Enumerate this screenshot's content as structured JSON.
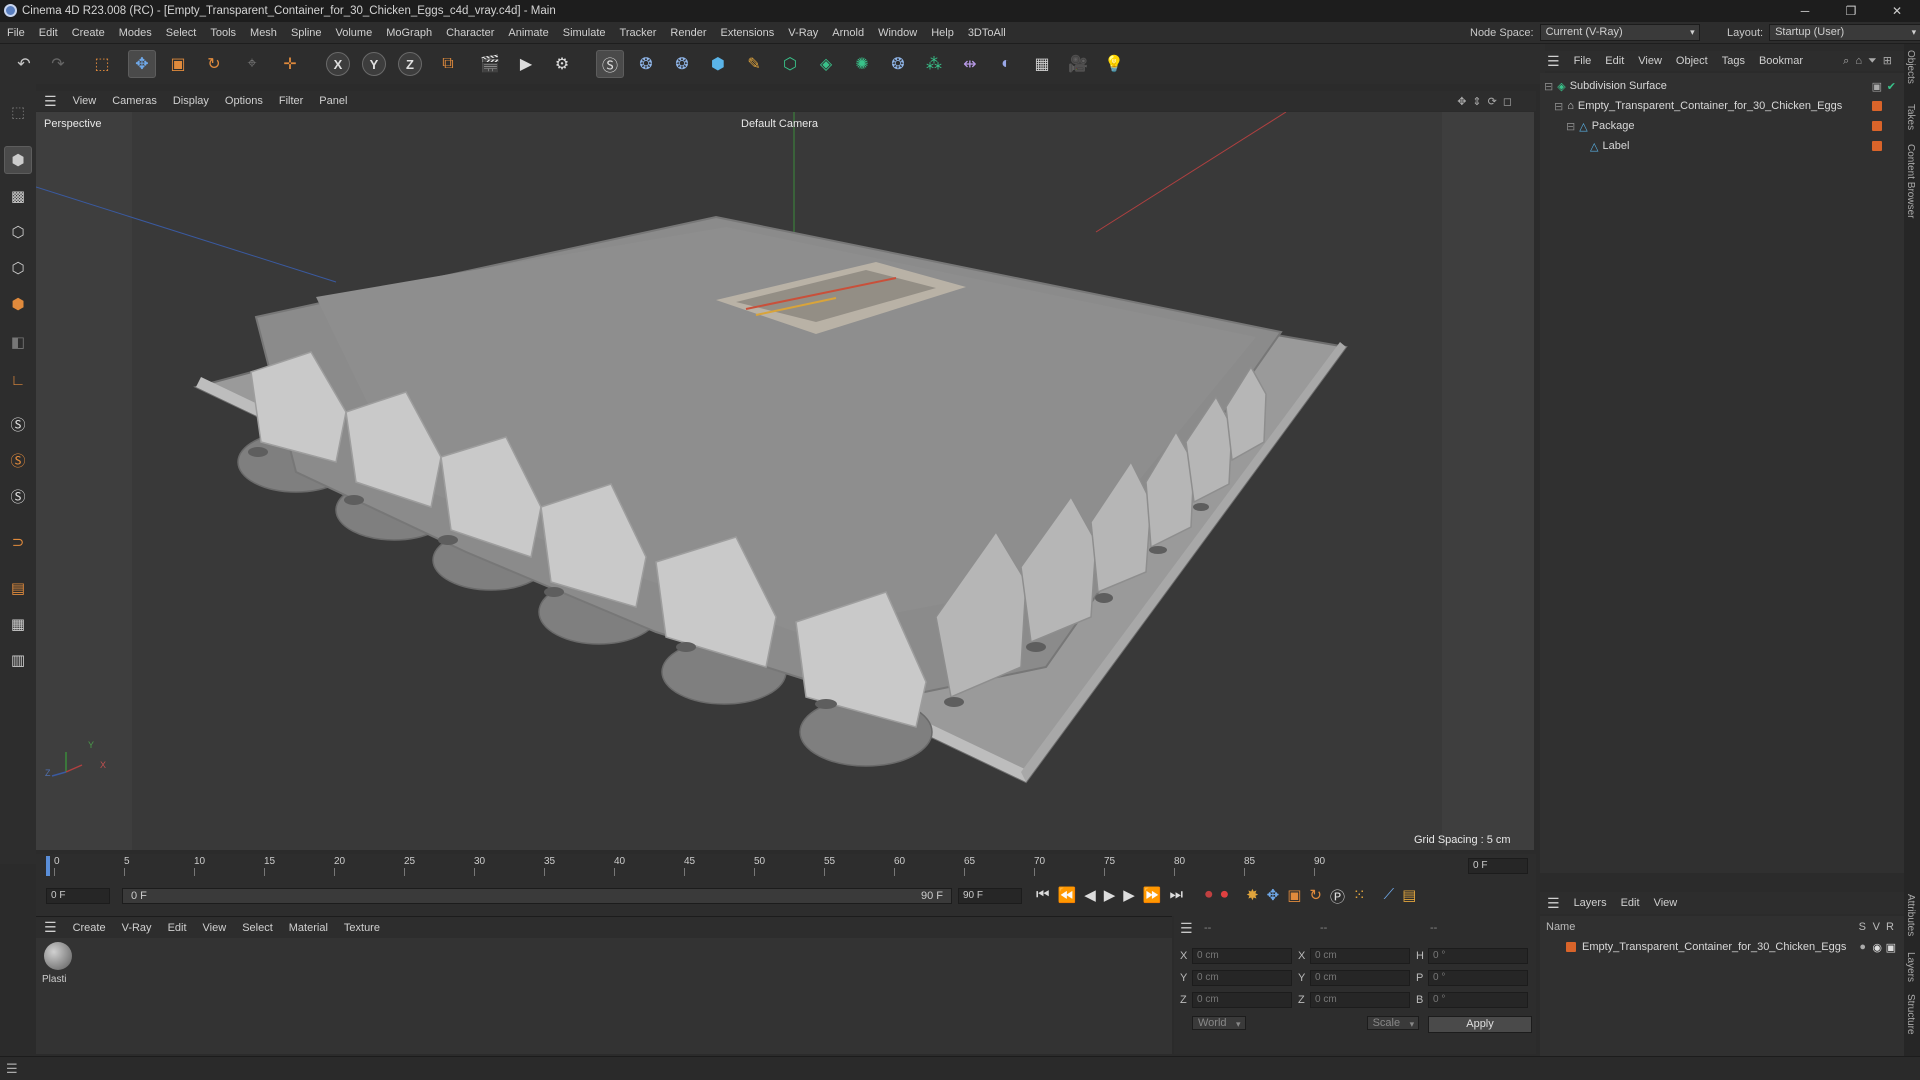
{
  "window": {
    "title": "Cinema 4D R23.008 (RC) - [Empty_Transparent_Container_for_30_Chicken_Eggs_c4d_vray.c4d] - Main",
    "min": "─",
    "max": "❐",
    "close": "✕"
  },
  "menubar": {
    "items": [
      "File",
      "Edit",
      "Create",
      "Modes",
      "Select",
      "Tools",
      "Mesh",
      "Spline",
      "Volume",
      "MoGraph",
      "Character",
      "Animate",
      "Simulate",
      "Tracker",
      "Render",
      "Extensions",
      "V-Ray",
      "Arnold",
      "Window",
      "Help",
      "3DToAll"
    ]
  },
  "nodespace": {
    "label": "Node Space:",
    "value": "Current (V-Ray)"
  },
  "layout": {
    "label": "Layout:",
    "value": "Startup (User)"
  },
  "viewport": {
    "menu": [
      "View",
      "Cameras",
      "Display",
      "Options",
      "Filter",
      "Panel"
    ],
    "name": "Perspective",
    "camera": "Default Camera",
    "grid_spacing": "Grid Spacing : 5 cm",
    "axis": {
      "x": "X",
      "y": "Y",
      "z": "Z"
    }
  },
  "timeline": {
    "ticks": [
      "0",
      "5",
      "10",
      "15",
      "20",
      "25",
      "30",
      "35",
      "40",
      "45",
      "50",
      "55",
      "60",
      "65",
      "70",
      "75",
      "80",
      "85",
      "90"
    ],
    "current_frame": "0 F",
    "start": "0 F",
    "range_start": "0 F",
    "range_end": "90 F",
    "end": "90 F"
  },
  "materials": {
    "menu": [
      "Create",
      "V-Ray",
      "Edit",
      "View",
      "Select",
      "Material",
      "Texture"
    ],
    "items": [
      {
        "name": "Plasti"
      }
    ]
  },
  "coords": {
    "header": [
      "--",
      "--",
      "--"
    ],
    "rows": [
      {
        "a": "X",
        "v1": "0 cm",
        "b": "X",
        "v2": "0 cm",
        "c": "H",
        "v3": "0 °"
      },
      {
        "a": "Y",
        "v1": "0 cm",
        "b": "Y",
        "v2": "0 cm",
        "c": "P",
        "v3": "0 °"
      },
      {
        "a": "Z",
        "v1": "0 cm",
        "b": "Z",
        "v2": "0 cm",
        "c": "B",
        "v3": "0 °"
      }
    ],
    "space": "World",
    "mode": "Scale",
    "apply": "Apply"
  },
  "objects": {
    "menu": [
      "File",
      "Edit",
      "View",
      "Object",
      "Tags",
      "Bookmar"
    ],
    "tree": [
      {
        "name": "Subdivision Surface",
        "depth": 0
      },
      {
        "name": "Empty_Transparent_Container_for_30_Chicken_Eggs",
        "depth": 1
      },
      {
        "name": "Package",
        "depth": 2
      },
      {
        "name": "Label",
        "depth": 3
      }
    ]
  },
  "layers": {
    "menu": [
      "Layers",
      "Edit",
      "View"
    ],
    "columns": {
      "name": "Name",
      "s": "S",
      "v": "V",
      "r": "R"
    },
    "rows": [
      {
        "name": "Empty_Transparent_Container_for_30_Chicken_Eggs"
      }
    ]
  },
  "sidetabs": [
    "Objects",
    "Takes",
    "Content Browser",
    "Attributes",
    "Layers",
    "Structure"
  ],
  "colors": {
    "accent": "#d9642a",
    "bg": "#2b2b2b",
    "viewport": "#3d3d3d"
  }
}
